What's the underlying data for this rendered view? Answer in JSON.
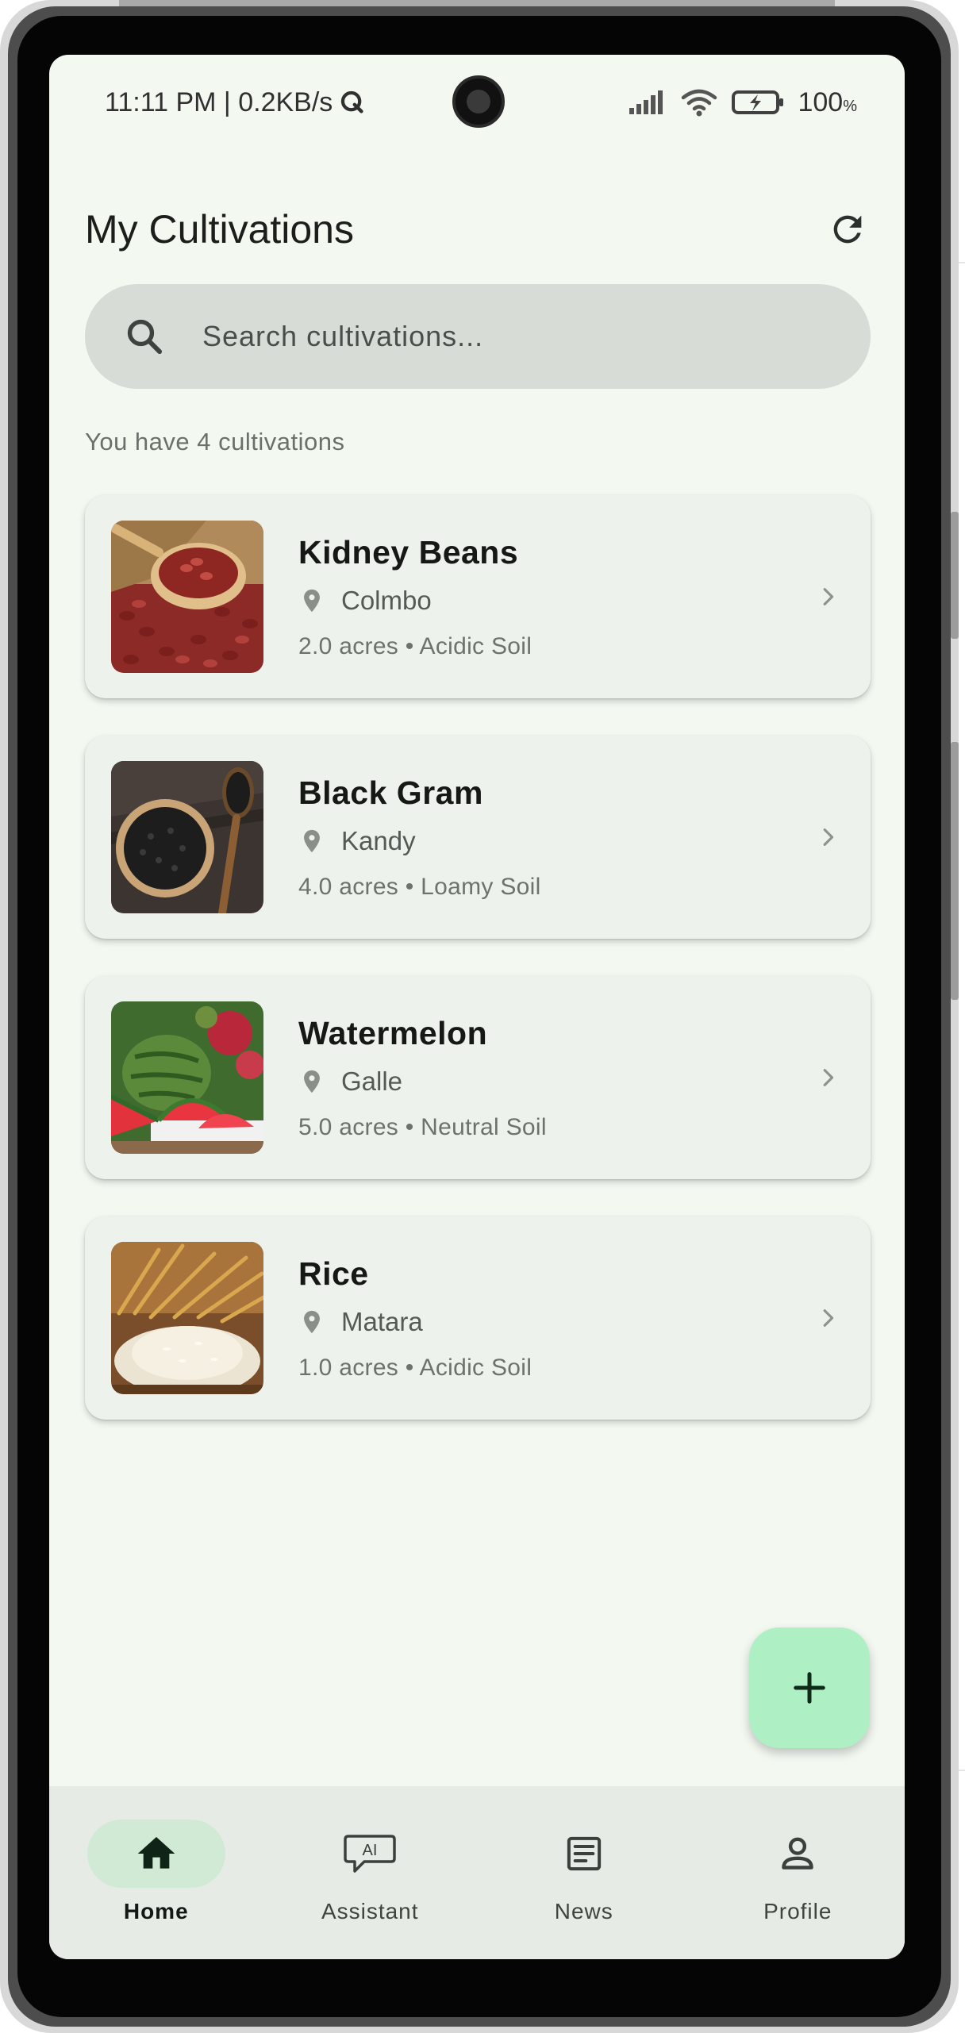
{
  "status_bar": {
    "time_speed": "11:11 PM | 0.2KB/s",
    "battery_value": "100",
    "battery_unit": "%"
  },
  "header": {
    "title": "My Cultivations",
    "refresh_icon": "refresh-icon"
  },
  "search": {
    "placeholder": "Search cultivations...",
    "icon": "search-icon"
  },
  "summary": {
    "count_text": "You have 4 cultivations"
  },
  "cultivations": [
    {
      "name": "Kidney Beans",
      "location": "Colmbo",
      "details": "2.0 acres • Acidic Soil"
    },
    {
      "name": "Black Gram",
      "location": "Kandy",
      "details": "4.0 acres • Loamy Soil"
    },
    {
      "name": "Watermelon",
      "location": "Galle",
      "details": "5.0 acres • Neutral Soil"
    },
    {
      "name": "Rice",
      "location": "Matara",
      "details": "1.0 acres • Acidic Soil"
    }
  ],
  "fab": {
    "icon": "plus-icon"
  },
  "bottom_nav": {
    "items": [
      {
        "label": "Home",
        "icon": "home-icon",
        "active": true
      },
      {
        "label": "Assistant",
        "icon": "ai-chat-icon",
        "active": false
      },
      {
        "label": "News",
        "icon": "news-icon",
        "active": false
      },
      {
        "label": "Profile",
        "icon": "person-icon",
        "active": false
      }
    ],
    "ai_badge_text": "AI"
  },
  "colors": {
    "screen_bg": "#f3f8f1",
    "card_bg": "#eef2ec",
    "fab_bg": "#aef0c4",
    "nav_active_pill": "#d1ead5",
    "nav_bg": "#e6ebe5"
  }
}
